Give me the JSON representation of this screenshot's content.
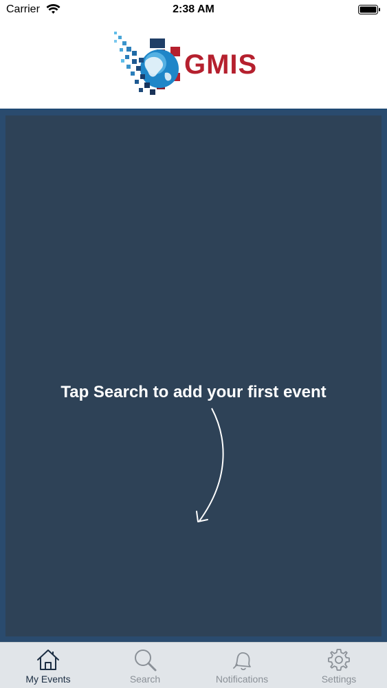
{
  "status_bar": {
    "carrier": "Carrier",
    "time": "2:38 AM"
  },
  "header": {
    "logo_text": "GMIS",
    "brand_color": "#b5202e"
  },
  "main": {
    "empty_message": "Tap Search to add your first event",
    "background_color": "#2e4257"
  },
  "tab_bar": {
    "tabs": [
      {
        "label": "My Events",
        "icon": "home-icon",
        "active": true
      },
      {
        "label": "Search",
        "icon": "search-icon",
        "active": false
      },
      {
        "label": "Notifications",
        "icon": "bell-icon",
        "active": false
      },
      {
        "label": "Settings",
        "icon": "gear-icon",
        "active": false
      }
    ]
  }
}
